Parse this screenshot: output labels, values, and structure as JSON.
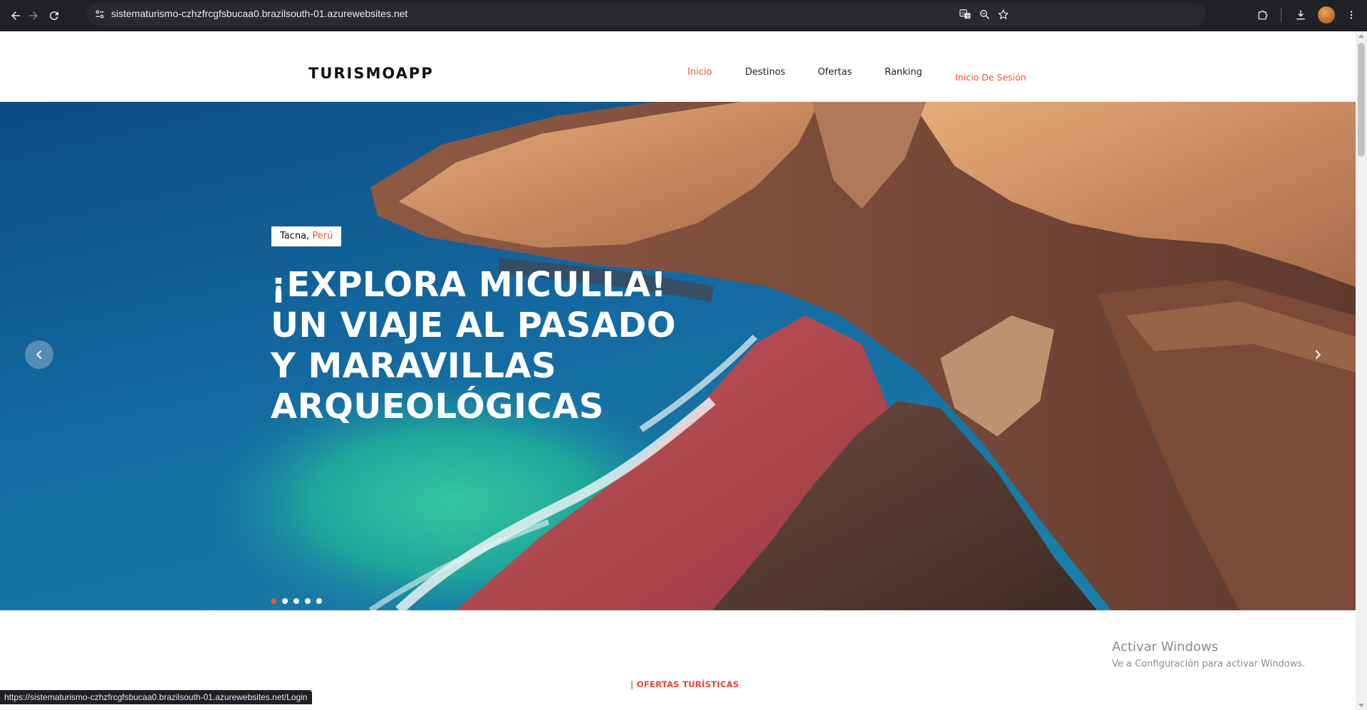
{
  "browser": {
    "url": "sistematurismo-czhzfrcgfsbucaa0.brazilsouth-01.azurewebsites.net",
    "status_url": "https://sistematurismo-czhzfrcgfsbucaa0.brazilsouth-01.azurewebsites.net/Login",
    "icons": [
      "back-icon",
      "forward-icon",
      "reload-icon",
      "site-info-icon",
      "translate-icon",
      "zoom-icon",
      "bookmark-star-icon",
      "extensions-icon",
      "download-icon",
      "profile-avatar",
      "menu-kebab-icon"
    ]
  },
  "header": {
    "brand": "TURISMOAPP",
    "nav": [
      "Inicio",
      "Destinos",
      "Ofertas",
      "Ranking"
    ],
    "active_nav": "Inicio",
    "login": "Inicio De Sesión",
    "accent_color": "#f0562d"
  },
  "hero": {
    "tag_city": "Tacna,",
    "tag_country": "Perú",
    "title_lines": [
      "¡EXPLORA MICULLA!",
      "UN VIAJE AL PASADO",
      "Y MARAVILLAS",
      "ARQUEOLÓGICAS"
    ],
    "slide_count": 5,
    "active_slide": 1,
    "prev_icon": "chevron-left-icon",
    "next_icon": "chevron-right-icon"
  },
  "offers": {
    "heading": "| OFERTAS TURÍSTICAS"
  },
  "watermark": {
    "line1": "Activar Windows",
    "line2": "Ve a Configuración para activar Windows."
  }
}
